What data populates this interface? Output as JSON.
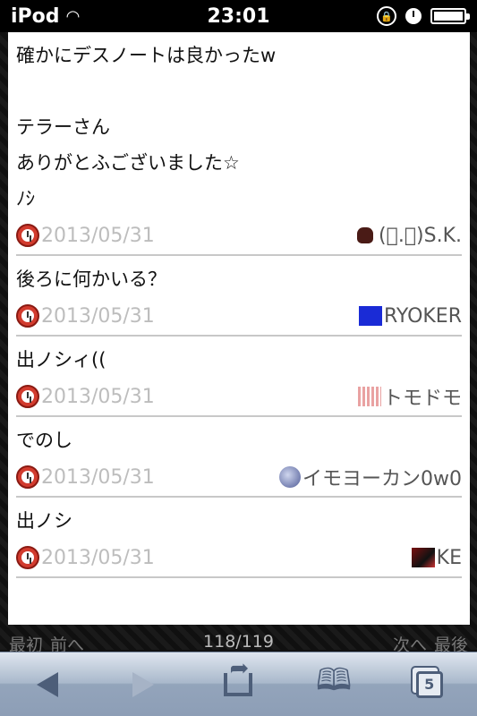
{
  "status_bar": {
    "carrier": "iPod",
    "time": "23:01"
  },
  "posts": [
    {
      "text": "確かにデスノートは良かったw\n\nテラーさん\nありがとふございました☆\nﾉｼ",
      "date": "2013/05/31",
      "user": "(ﾟ.ﾟ)S.K.",
      "avatar": "hand"
    },
    {
      "text": "後ろに何かいる？",
      "date": "2013/05/31",
      "user": "RYOKER",
      "avatar": "blue"
    },
    {
      "text": "出ノシィ((",
      "date": "2013/05/31",
      "user": "トモドモ",
      "avatar": "pink"
    },
    {
      "text": "でのし",
      "date": "2013/05/31",
      "user": "イモヨーカン0w0",
      "avatar": "globe"
    },
    {
      "text": "出ノシ",
      "date": "2013/05/31",
      "user": "KE",
      "avatar": "dark"
    }
  ],
  "pager": {
    "first": "最初",
    "prev": "前へ",
    "position": "118/119",
    "next": "次へ",
    "last": "最後"
  },
  "toolbar": {
    "tabs_count": "5"
  },
  "icons": {
    "back": "back-arrow-icon",
    "forward": "forward-arrow-icon",
    "share": "share-icon",
    "bookmarks": "bookmarks-icon",
    "tabs": "tabs-icon"
  }
}
